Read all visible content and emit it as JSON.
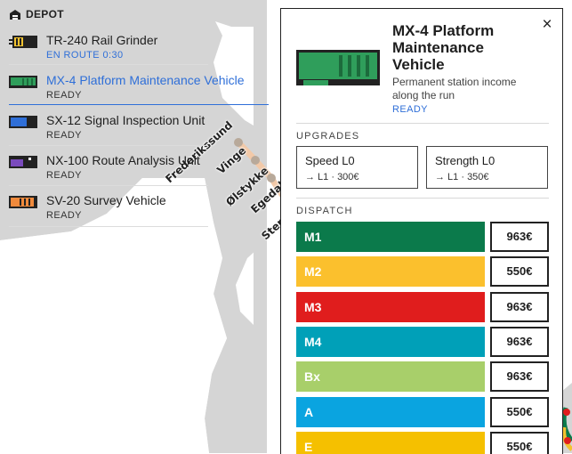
{
  "depot": {
    "header": "DEPOT",
    "vehicles": [
      {
        "name": "TR-240 Rail Grinder",
        "status": "EN ROUTE 0:30",
        "color": "#f2c230"
      },
      {
        "name": "MX-4 Platform Maintenance Vehicle",
        "status": "READY",
        "color": "#2f9e5b"
      },
      {
        "name": "SX-12 Signal Inspection Unit",
        "status": "READY",
        "color": "#2f6fd8"
      },
      {
        "name": "NX-100 Route Analysis Unit",
        "status": "READY",
        "color": "#7a4bbd"
      },
      {
        "name": "SV-20 Survey Vehicle",
        "status": "READY",
        "color": "#f08a3c"
      }
    ]
  },
  "map": {
    "stations": [
      "Frederikssund",
      "Vinge",
      "Ølstykke",
      "Egedal",
      "Stenløse"
    ]
  },
  "panel": {
    "title": "MX-4 Platform Maintenance Vehicle",
    "description": "Permanent station income along the run",
    "status": "READY",
    "close_icon": "×",
    "upgrades_label": "UPGRADES",
    "upgrades": [
      {
        "name": "Speed L0",
        "cost": "→ L1 · 300€"
      },
      {
        "name": "Strength L0",
        "cost": "→ L1 · 350€"
      }
    ],
    "dispatch_label": "DISPATCH",
    "lines": [
      {
        "name": "M1",
        "price": "963€",
        "color": "#0b7a4b"
      },
      {
        "name": "M2",
        "price": "550€",
        "color": "#fbc02d"
      },
      {
        "name": "M3",
        "price": "963€",
        "color": "#e01d1d"
      },
      {
        "name": "M4",
        "price": "963€",
        "color": "#00a0b8"
      },
      {
        "name": "Bx",
        "price": "963€",
        "color": "#a8cf6a"
      },
      {
        "name": "A",
        "price": "550€",
        "color": "#0aa4e0"
      },
      {
        "name": "E",
        "price": "550€",
        "color": "#f5c000"
      }
    ]
  }
}
